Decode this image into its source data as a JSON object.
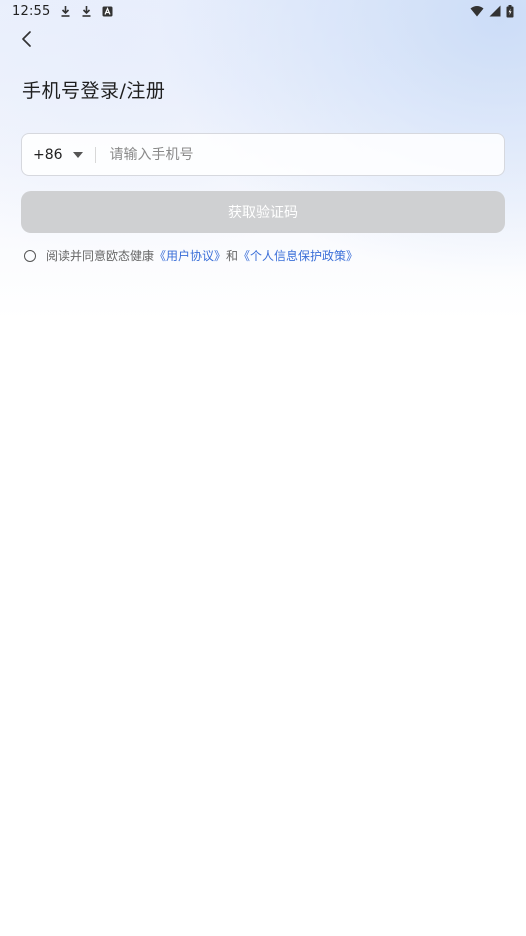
{
  "status_bar": {
    "time": "12:55",
    "left_icons": [
      "download-icon",
      "download-icon",
      "app-a-icon"
    ],
    "right_icons": [
      "wifi-icon",
      "cell-signal-icon",
      "battery-charging-icon"
    ]
  },
  "header": {
    "back_icon": "chevron-left-icon",
    "title": "手机号登录/注册"
  },
  "phone_field": {
    "country_code": "+86",
    "placeholder": "请输入手机号",
    "value": ""
  },
  "code_button": {
    "label": "获取验证码",
    "state": "disabled",
    "background": "#cfd0d2"
  },
  "agreement": {
    "checked": false,
    "prefix": "阅读并同意欧态健康",
    "user_agreement": "《用户协议》",
    "conjunction": "和",
    "privacy_policy": "《个人信息保护政策》",
    "link_color": "#3b6fd8"
  }
}
